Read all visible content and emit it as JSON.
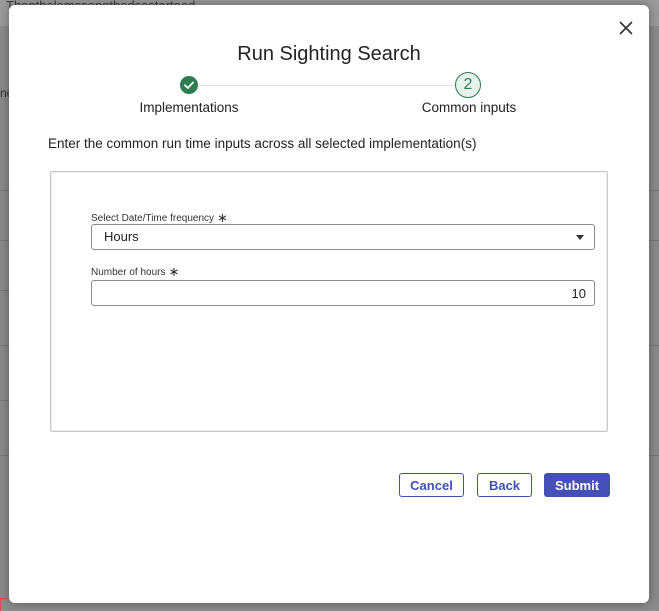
{
  "background": {
    "top_text": "Thenthelemssongthedsastartaed",
    "side_text": "nc"
  },
  "dialog": {
    "title": "Run Sighting Search",
    "close_icon": "close-icon",
    "steps": [
      {
        "label": "Implementations",
        "status": "completed",
        "icon": "check-icon"
      },
      {
        "label": "Common inputs",
        "number": "2",
        "status": "active"
      }
    ],
    "instructions": "Enter the common run time inputs across all selected implementation(s)",
    "fields": {
      "frequency": {
        "label": "Select Date/Time frequency",
        "required_mark": "∗",
        "value": "Hours"
      },
      "hours": {
        "label": "Number of hours",
        "required_mark": "∗",
        "value": "10"
      }
    },
    "buttons": {
      "cancel": "Cancel",
      "back": "Back",
      "submit": "Submit"
    }
  },
  "colors": {
    "accent": "#4450b8",
    "success": "#2e7d4f"
  }
}
